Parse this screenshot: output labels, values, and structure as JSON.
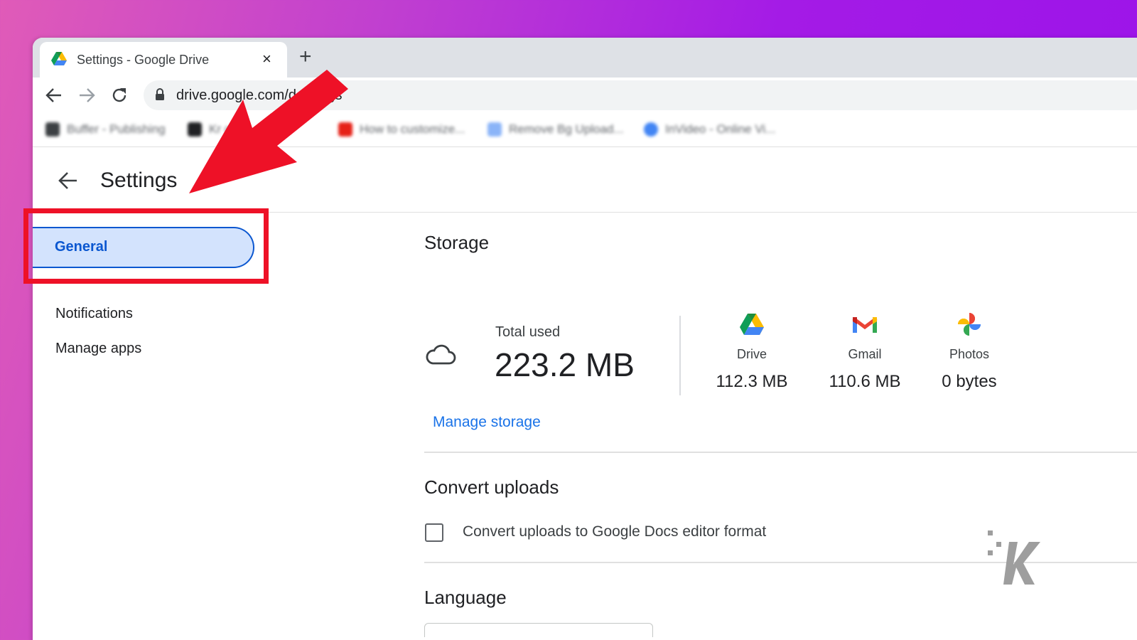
{
  "browser": {
    "tab_title": "Settings - Google Drive",
    "tab_close": "×",
    "new_tab": "+",
    "url": "drive.google.com/d       ettings",
    "bookmarks": [
      {
        "label": "Buffer - Publishing",
        "color": "#3c4043"
      },
      {
        "label": "Kr                       ch...",
        "color": "#202124"
      },
      {
        "label": "How to customize...",
        "color": "#e62117"
      },
      {
        "label": "Remove Bg Upload...",
        "color": "#8ab4f8"
      },
      {
        "label": "InVideo - Online Vi...",
        "color": "#4285f4"
      }
    ]
  },
  "settings": {
    "title": "Settings",
    "sidebar": {
      "items": [
        {
          "label": "General",
          "selected": true
        },
        {
          "label": "Notifications"
        },
        {
          "label": "Manage apps"
        }
      ]
    },
    "storage": {
      "title": "Storage",
      "total_label": "Total used",
      "total_value": "223.2 MB",
      "services": [
        {
          "name": "Drive",
          "size": "112.3 MB",
          "icon": "google-drive-icon"
        },
        {
          "name": "Gmail",
          "size": "110.6 MB",
          "icon": "gmail-icon"
        },
        {
          "name": "Photos",
          "size": "0 bytes",
          "icon": "google-photos-icon"
        }
      ],
      "manage_link": "Manage storage"
    },
    "convert_uploads": {
      "title": "Convert uploads",
      "checkbox_label": "Convert uploads to Google Docs editor format",
      "checked": false
    },
    "language": {
      "title": "Language"
    }
  },
  "colors": {
    "accent": "#0b57d0",
    "link": "#1a73e8",
    "annotation_red": "#ee1127"
  }
}
